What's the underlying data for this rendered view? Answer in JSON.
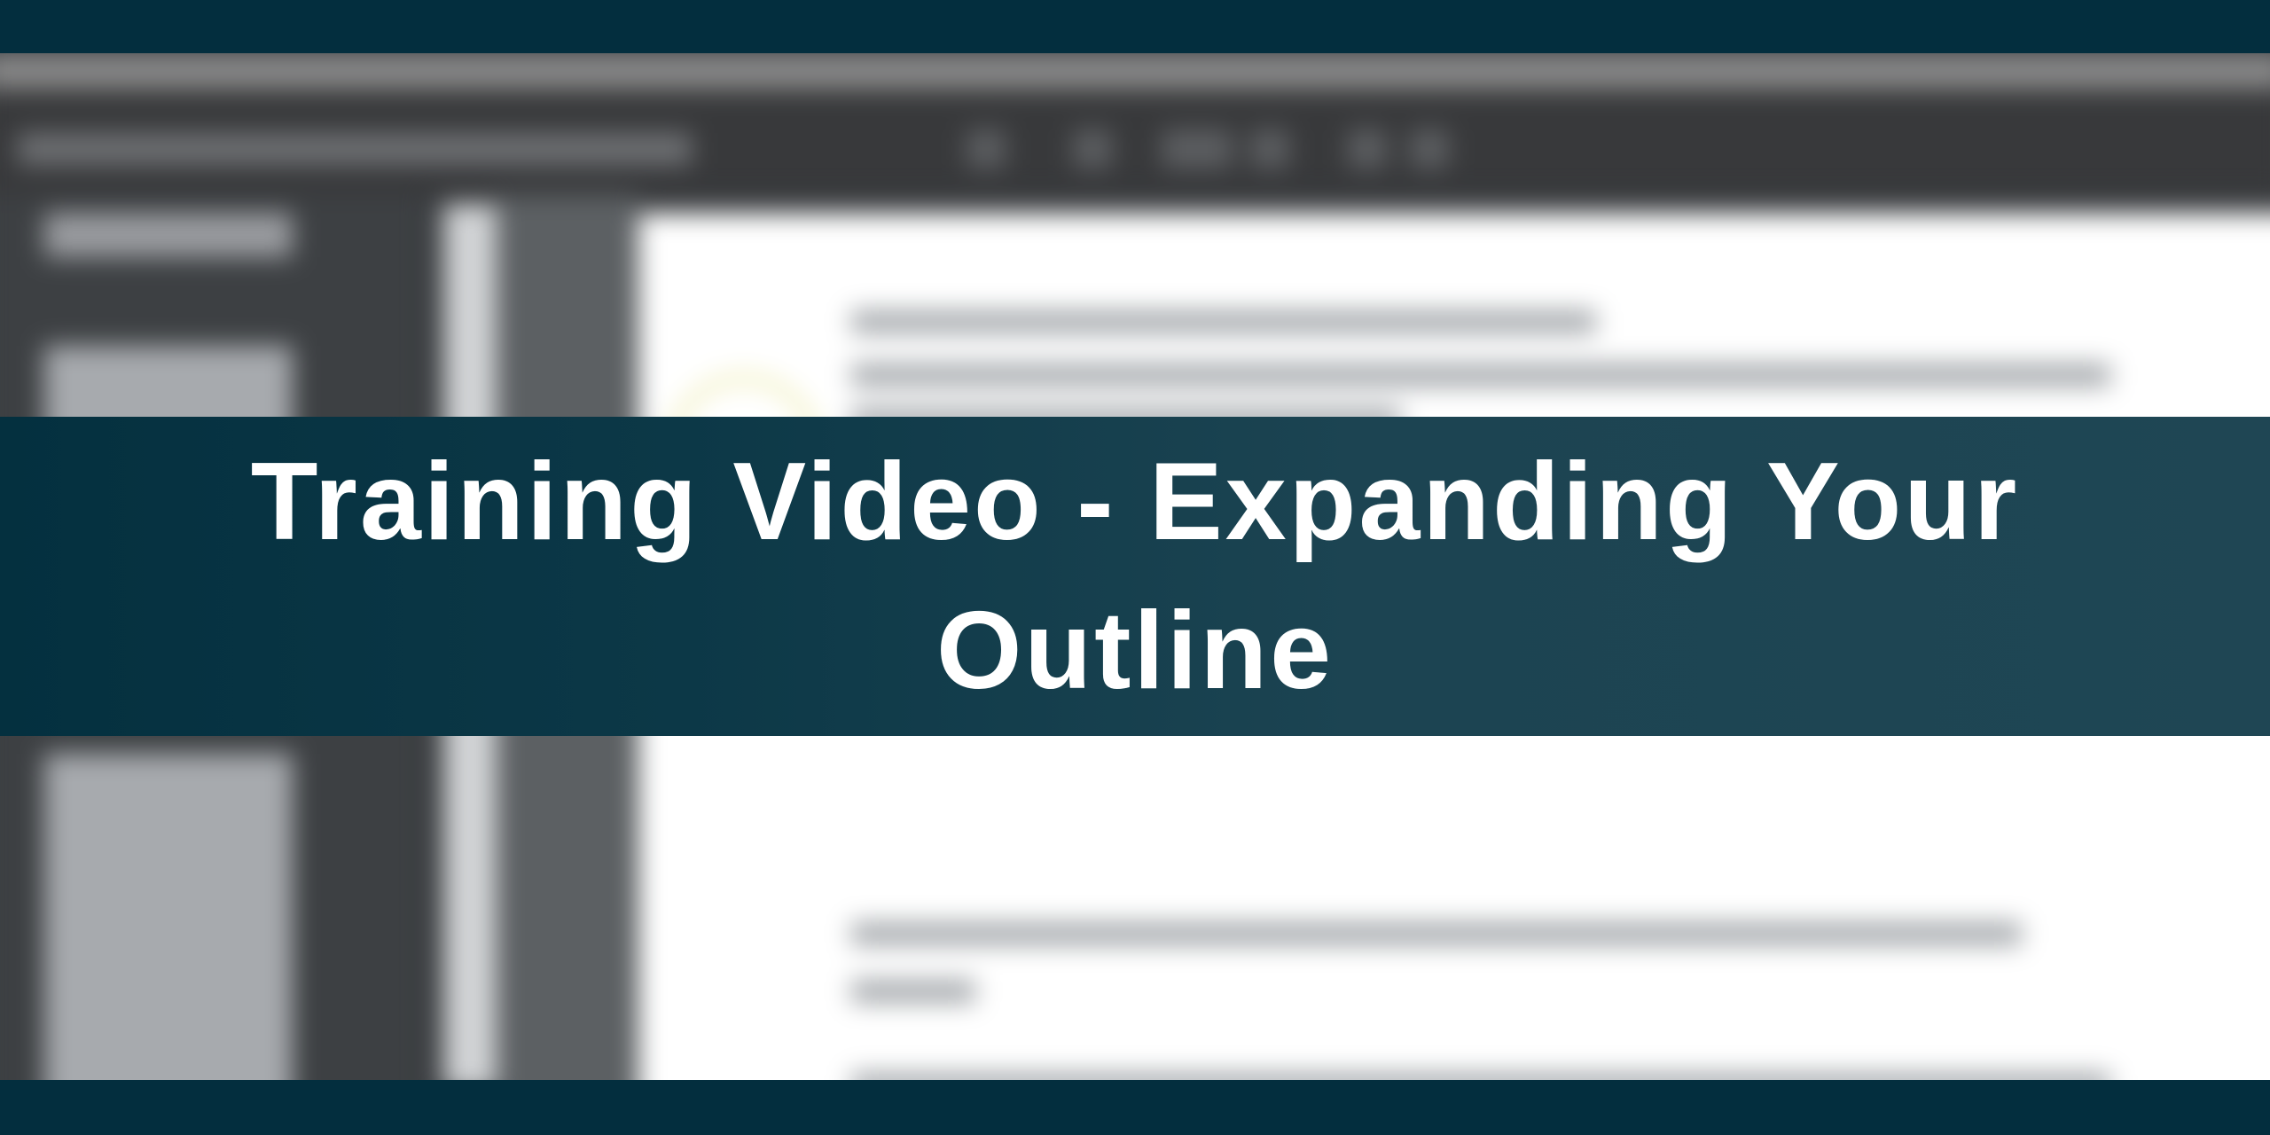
{
  "banner": {
    "title": "Training Video - Expanding Your Outline"
  },
  "colors": {
    "frame": "#032e3e",
    "banner": "#1c4452",
    "title_text": "#ffffff"
  }
}
